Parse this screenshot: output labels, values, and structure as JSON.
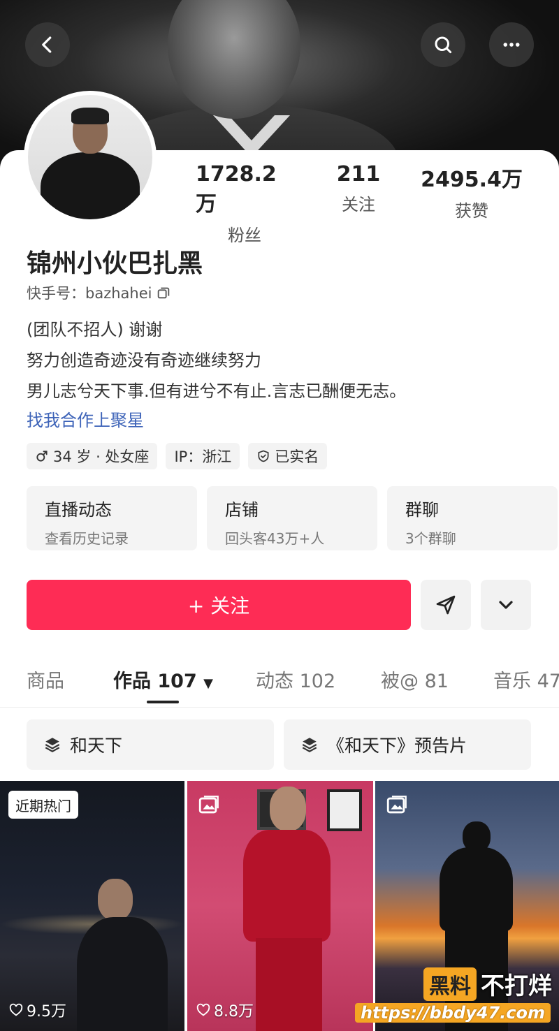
{
  "header": {
    "back_icon": "chevron-left-icon",
    "search_icon": "search-icon",
    "more_icon": "more-horizontal-icon"
  },
  "profile": {
    "stats": [
      {
        "value": "1728.2万",
        "label": "粉丝"
      },
      {
        "value": "211",
        "label": "关注"
      },
      {
        "value": "2495.4万",
        "label": "获赞"
      }
    ],
    "name": "锦州小伙巴扎黑",
    "kuaishou_id": "快手号：bazhahei",
    "bio": [
      "(团队不招人) 谢谢",
      "努力创造奇迹没有奇迹继续努力",
      "男儿志兮天下事.但有进兮不有止.言志已酬便无志。"
    ],
    "link_text": "找我合作上聚星",
    "tags": [
      "34 岁 · 处女座",
      "IP：浙江",
      "已实名"
    ]
  },
  "tiles": [
    {
      "title": "直播动态",
      "subtitle": "查看历史记录"
    },
    {
      "title": "店铺",
      "subtitle": "回头客43万+人"
    },
    {
      "title": "群聊",
      "subtitle": "3个群聊"
    }
  ],
  "actions": {
    "follow_label": "+ 关注"
  },
  "tabs": [
    {
      "label": "商品"
    },
    {
      "label": "作品 107"
    },
    {
      "label": "动态 102"
    },
    {
      "label": "被@ 81"
    },
    {
      "label": "音乐 47"
    }
  ],
  "collections": [
    "和天下",
    "《和天下》预告片"
  ],
  "videos": [
    {
      "badge": "近期热门",
      "likes": "9.5万"
    },
    {
      "likes": "8.8万"
    },
    {
      "likes": ""
    }
  ],
  "watermark": {
    "box": "黑料",
    "text": "不打烊",
    "url": "https://bbdy47.com"
  },
  "colors": {
    "accent": "#fe2c55",
    "link": "#3d63b8"
  }
}
